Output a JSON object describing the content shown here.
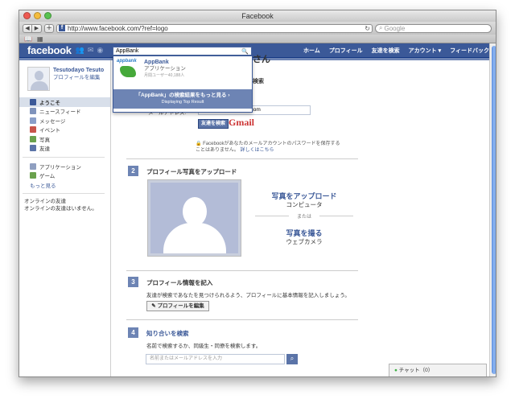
{
  "browser": {
    "title": "Facebook",
    "url": "http://www.facebook.com/?ref=logo",
    "search_placeholder": "Google"
  },
  "header": {
    "logo": "facebook",
    "search_value": "AppBank",
    "nav": [
      "ホーム",
      "プロフィール",
      "友達を検索",
      "アカウント ▾",
      "フィードバック"
    ]
  },
  "dropdown": {
    "logo_text": "appbank",
    "name": "AppBank",
    "type": "アプリケーション",
    "users": "月間ユーザー40,188人",
    "more_line1": "「AppBank」の検索結果をもっと見る ›",
    "more_line2": "Displaying Top Result"
  },
  "sidebar": {
    "user_name": "Tesutodayo Tesuto",
    "edit_profile": "プロフィールを編集",
    "items": [
      {
        "label": "ようこそ",
        "icon": "facebook-icon",
        "color": "#3b5998"
      },
      {
        "label": "ニュースフィード",
        "icon": "newsfeed-icon",
        "color": "#7f93bc"
      },
      {
        "label": "メッセージ",
        "icon": "message-icon",
        "color": "#8a9fc9"
      },
      {
        "label": "イベント",
        "icon": "calendar-icon",
        "color": "#c8554b"
      },
      {
        "label": "写真",
        "icon": "photo-icon",
        "color": "#6aa14d"
      },
      {
        "label": "友達",
        "icon": "friends-icon",
        "color": "#5b74a8"
      }
    ],
    "apps": [
      {
        "label": "アプリケーション",
        "icon": "apps-icon",
        "color": "#8f9fc0"
      },
      {
        "label": "ゲーム",
        "icon": "games-icon",
        "color": "#6aa14d"
      }
    ],
    "more": "もっと見る",
    "online_title": "オンラインの友達",
    "online_none": "オンラインの友達はいません。"
  },
  "main": {
    "heading": "さん",
    "step1_label": "検索",
    "email_label": "メールアドレス:",
    "email_value": "economytrap@gmail.com",
    "find_friends_btn": "友達を検索",
    "gmail": "Gmail",
    "privacy_line1": "🔒 Facebookがあなたのメールアカウントのパスワードを保存する",
    "privacy_line2": "ことはありません。",
    "privacy_link": "詳しくはこちら",
    "step2": {
      "num": "2",
      "title": "プロフィール写真をアップロード"
    },
    "upload_photo": "写真をアップロード",
    "upload_computer": "コンピュータ",
    "or": "または",
    "take_photo": "写真を撮る",
    "webcam": "ウェブカメラ",
    "step3": {
      "num": "3",
      "title": "プロフィール情報を記入",
      "desc": "友達が検索であなたを見つけられるよう、プロフィールに基本情報を記入しましょう。",
      "btn": "✎ プロフィールを編集"
    },
    "step4": {
      "num": "4",
      "title": "知り合いを検索",
      "desc": "名前で検索するか、同級生・同僚を検索します。",
      "placeholder": "名前またはメールアドレスを入力"
    }
  },
  "chat": {
    "label": "チャット（0）"
  }
}
